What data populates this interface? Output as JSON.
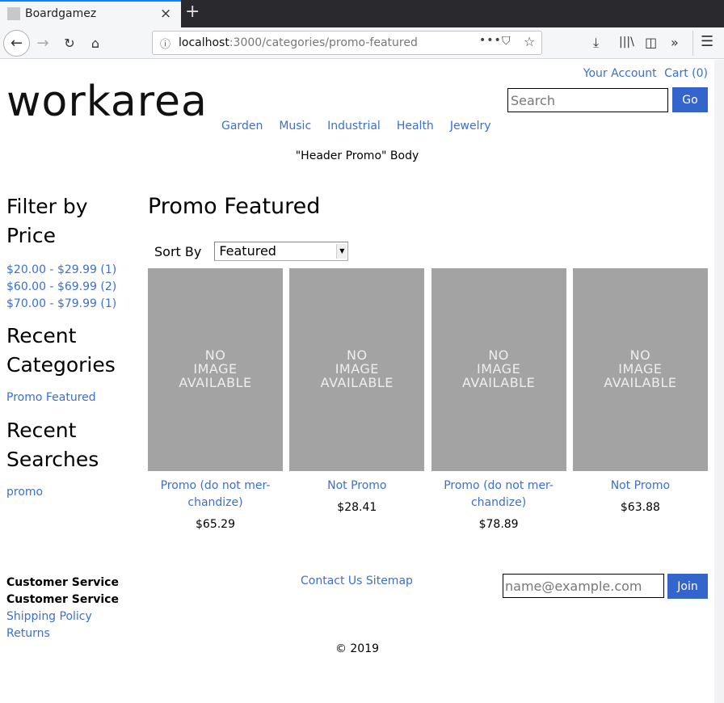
{
  "browser": {
    "tab_title": "Boardgamez",
    "close_tab_glyph": "×",
    "new_tab_glyph": "+",
    "url_host": "localhost",
    "url_rest": ":3000/categories/promo-featured",
    "icons": {
      "back": "←",
      "forward": "→",
      "reload": "↻",
      "home": "⌂",
      "info": "ⓘ",
      "page_actions": "•••",
      "pocket": "⛉",
      "bookmark": "☆",
      "downloads": "⤓",
      "library": "|||\\",
      "sidebar": "◫",
      "overflow": "»",
      "menu": "☰"
    }
  },
  "header": {
    "logo": "workarea",
    "account_link": "Your Account",
    "cart_link": "Cart (0)",
    "search_placeholder": "Search",
    "search_button": "Go",
    "nav": [
      "Garden",
      "Music",
      "Industrial",
      "Health",
      "Jewelry"
    ],
    "promo": "\"Header Promo\" Body"
  },
  "sidebar": {
    "filter_heading": "Filter by Price",
    "price_filters": [
      "$20.00 - $29.99 (1)",
      "$60.00 - $69.99 (2)",
      "$70.00 - $79.99 (1)"
    ],
    "recent_categories_heading": "Recent Categories",
    "recent_category": "Promo Featured",
    "recent_searches_heading": "Recent Searches",
    "recent_search": "promo"
  },
  "main": {
    "title": "Promo Featured",
    "sort_label": "Sort By",
    "sort_selected": "Featured",
    "no_image_text": [
      "NO",
      "IMAGE",
      "AVAILABLE"
    ],
    "products": [
      {
        "name": "Promo (do not mer-chandize)",
        "price": "$65.29"
      },
      {
        "name": "Not Promo",
        "price": "$28.41"
      },
      {
        "name": "Promo (do not mer-chandize)",
        "price": "$78.89"
      },
      {
        "name": "Not Promo",
        "price": "$63.88"
      }
    ]
  },
  "footer": {
    "heading1": "Customer Service",
    "heading2": "Customer Service",
    "shipping": "Shipping Policy",
    "returns": "Returns",
    "contact": "Contact Us",
    "sitemap": "Sitemap",
    "email_placeholder": "name@example.com",
    "join_button": "Join",
    "copyright": "© 2019"
  },
  "colors": {
    "link": "#3b6fd1",
    "button": "#3465cc",
    "placeholder_image": "#a3a3a3"
  }
}
